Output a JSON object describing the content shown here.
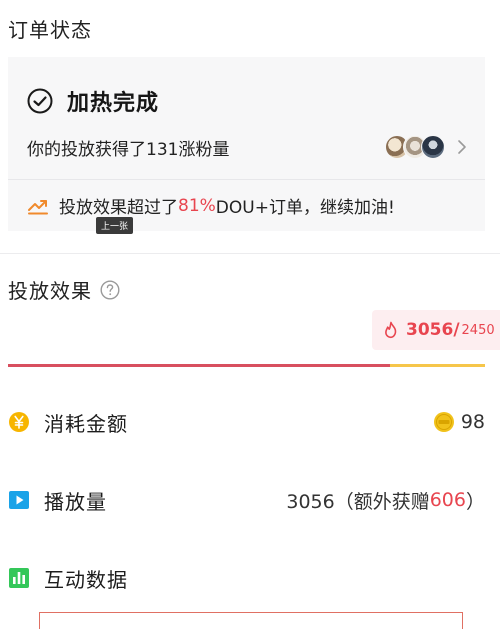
{
  "order_status": {
    "title": "订单状态"
  },
  "status_card": {
    "status_label": "加热完成",
    "fans_text": "你的投放获得了131涨粉量",
    "compare": {
      "prefix": "投放效果超过了",
      "percent": "81%",
      "suffix": "DOU+订单，继续加油!"
    },
    "tooltip": "上一张"
  },
  "effect": {
    "title": "投放效果",
    "badge_value": "3056/",
    "badge_target": "2450",
    "progress_fraction": 0.8
  },
  "metrics": {
    "cost": {
      "label": "消耗金额",
      "value": "98",
      "icon": "yuan-icon"
    },
    "plays": {
      "label": "播放量",
      "main": "3056（额外获赠",
      "bonus": "606",
      "close": "）",
      "icon": "play-icon"
    },
    "interact": {
      "label": "互动数据",
      "icon": "bar-chart-icon"
    }
  },
  "colors": {
    "accent_red": "#e8454f",
    "progress_yellow": "#f6c64a",
    "progress_red": "#d84f5f"
  }
}
